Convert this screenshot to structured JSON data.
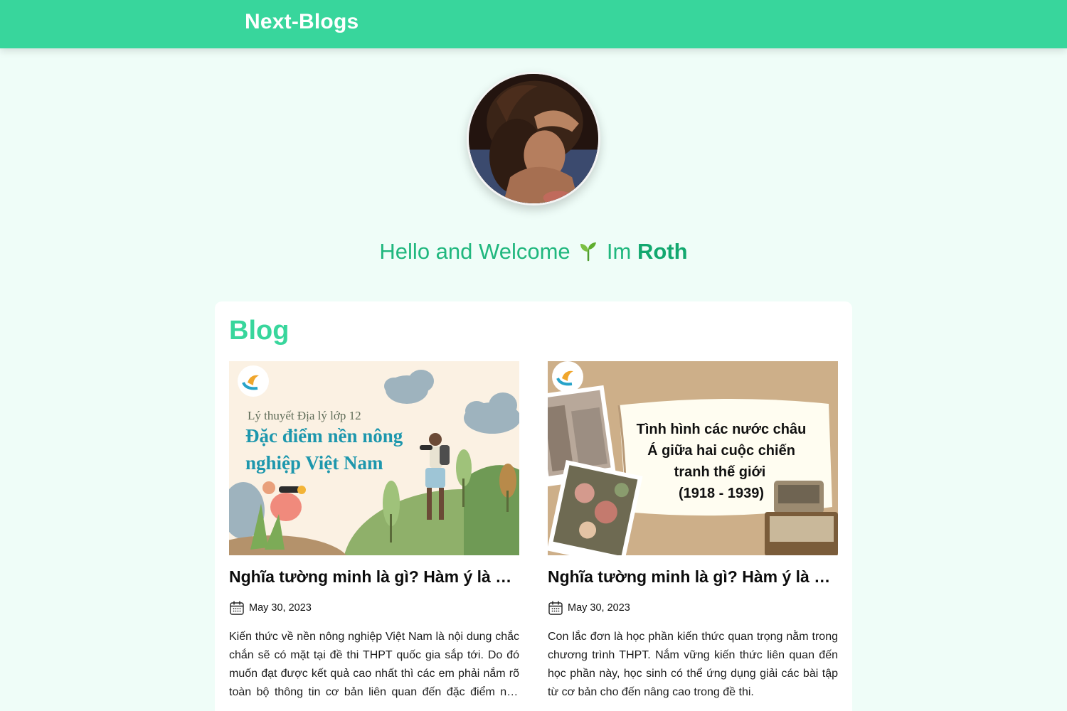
{
  "header": {
    "brand": "Next-Blogs",
    "bg_color": "#38d69c"
  },
  "profile": {
    "avatar_alt": "profile photo",
    "greeting": "Hello and Welcome",
    "emoji_icon": "sprout-icon",
    "im_text": "Im",
    "name": "Roth"
  },
  "blog": {
    "title": "Blog",
    "posts": [
      {
        "image_subtitle": "Lý thuyết Địa lý lớp 12",
        "image_title_line1": "Đặc điểm nền nông",
        "image_title_line2": "nghiệp Việt Nam",
        "image_logo": "HỌC THÔNG MINH",
        "title": "Nghĩa tường minh là gì? Hàm ý là gì? Cách sử dụng",
        "date": "May 30, 2023",
        "excerpt": "Kiến thức về nền nông nghiệp Việt Nam là nội dung chắc chắn sẽ có mặt tại đề thi THPT quốc gia sắp tới. Do đó muốn đạt được kết quả cao nhất thì các em phải nắm rõ toàn bộ thông tin cơ bản liên quan đến đặc điểm nền nông nghiệp Việt Nam."
      },
      {
        "image_title_line1": "Tình hình các nước châu",
        "image_title_line2": "Á giữa hai cuộc chiến",
        "image_title_line3": "tranh thế giới",
        "image_title_line4": "(1918 - 1939)",
        "image_logo": "HỌC THÔNG MINH",
        "title": "Nghĩa tường minh là gì? Hàm ý là gì? Cách sử dụng",
        "date": "May 30, 2023",
        "excerpt": "Con lắc đơn là học phần kiến thức quan trọng nằm trong chương trình THPT. Nắm vững kiến thức liên quan đến học phần này, học sinh có thể ứng dụng giải các bài tập từ cơ bản cho đến nâng cao trong đề thi."
      }
    ]
  },
  "colors": {
    "accent": "#38d69c",
    "greeting": "#20b77e",
    "page_bg": "#effdf8"
  }
}
